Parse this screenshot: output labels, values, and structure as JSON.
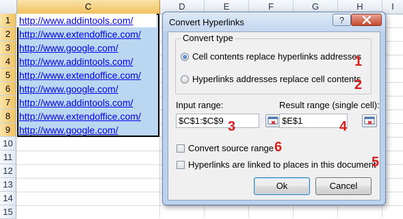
{
  "sheet": {
    "columns": [
      "C",
      "D",
      "E",
      "F",
      "G",
      "H",
      "I"
    ],
    "rows": [
      "1",
      "2",
      "3",
      "4",
      "5",
      "6",
      "7",
      "8",
      "9",
      "10",
      "11",
      "12",
      "13",
      "14",
      "15"
    ],
    "cells": [
      "http://www.addintools.com/",
      "http://www.extendoffice.com/",
      "http://www.google.com/",
      "http://www.addintools.com/",
      "http://www.extendoffice.com/",
      "http://www.google.com/",
      "http://www.addintools.com/",
      "http://www.extendoffice.com/",
      "http://www.google.com/"
    ]
  },
  "dialog": {
    "title": "Convert Hyperlinks",
    "help_label": "?",
    "close_label": "x",
    "convert_type": {
      "legend": "Convert type",
      "options": [
        {
          "label": "Cell contents replace hyperlinks addresses",
          "selected": true
        },
        {
          "label": "Hyperlinks addresses replace cell contents",
          "selected": false
        }
      ]
    },
    "input_range": {
      "label": "Input range:",
      "value": "$C$1:$C$9"
    },
    "result_range": {
      "label": "Result range (single cell):",
      "value": "$E$1"
    },
    "convert_source_range": {
      "label": "Convert source range",
      "checked": false
    },
    "hyperlinks_linked": {
      "label": "Hyperlinks are linked to places in this document",
      "checked": false
    },
    "ok_label": "Ok",
    "cancel_label": "Cancel"
  },
  "annotations": [
    "1",
    "2",
    "3",
    "4",
    "5",
    "6"
  ],
  "colors": {
    "annotation": "#d81d1d",
    "selection": "#bbd6f1",
    "dialog_frame": "#bcd2ec",
    "link": "#0000ee"
  }
}
